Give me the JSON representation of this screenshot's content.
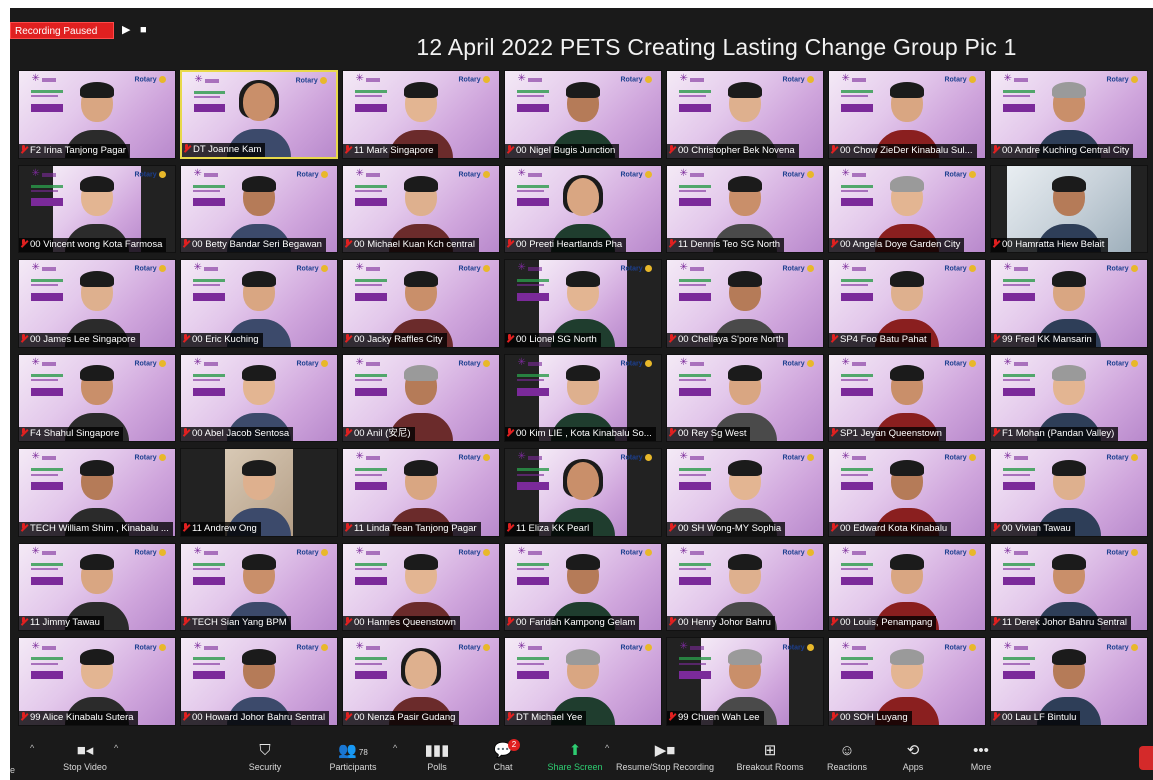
{
  "recording": {
    "status_label": "Recording Paused",
    "resume_icon": "play-icon",
    "stop_icon": "stop-icon"
  },
  "meeting_title": "12 April 2022 PETS Creating Lasting Change Group Pic 1",
  "colors": {
    "window_bg": "#1a1a1a",
    "recording_red": "#e02020",
    "active_speaker_border": "#e8d94a",
    "share_green": "#2ecc71",
    "tile_gradient_light": "#f4eaf6",
    "tile_gradient_dark": "#b889cc"
  },
  "background_branding": {
    "rotary_text": "Rotary"
  },
  "participants": [
    {
      "name": "F2 Irina Tanjong Pagar"
    },
    {
      "name": "DT Joanne Kam"
    },
    {
      "name": "11 Mark Singapore"
    },
    {
      "name": "00 Nigel Bugis Junction"
    },
    {
      "name": "00 Christopher Bek Novena"
    },
    {
      "name": "00 Chow ZieDer Kinabalu Sul..."
    },
    {
      "name": "00 Andre Kuching Central City"
    },
    {
      "name": "00 Vincent wong Kota Farmosa"
    },
    {
      "name": "00 Betty Bandar Seri Begawan"
    },
    {
      "name": "00 Michael Kuan Kch central"
    },
    {
      "name": "00 Preeti Heartlands Pha"
    },
    {
      "name": "11 Dennis Teo SG North"
    },
    {
      "name": "00 Angela Doye Garden City"
    },
    {
      "name": "00 Hamratta Hiew Belait"
    },
    {
      "name": "00 James Lee Singapore"
    },
    {
      "name": "00 Eric Kuching"
    },
    {
      "name": "00 Jacky Raffles City"
    },
    {
      "name": "00 Lionel SG North"
    },
    {
      "name": "00 Chellaya S'pore North"
    },
    {
      "name": "SP4 Foo Batu Pahat"
    },
    {
      "name": "99 Fred KK Mansarin"
    },
    {
      "name": "F4 Shahul Singapore"
    },
    {
      "name": "00 Abel Jacob Sentosa"
    },
    {
      "name": "00 Anil (安尼)"
    },
    {
      "name": "00 Kim LIE , Kota Kinabalu So..."
    },
    {
      "name": "00 Rey Sg West"
    },
    {
      "name": "SP1 Jeyan Queenstown"
    },
    {
      "name": "F1 Mohan (Pandan Valley)"
    },
    {
      "name": "TECH William Shim , Kinabalu ..."
    },
    {
      "name": "11 Andrew Ong"
    },
    {
      "name": "11 Linda Tean Tanjong Pagar"
    },
    {
      "name": "11 Eliza KK Pearl"
    },
    {
      "name": "00 SH Wong-MY Sophia"
    },
    {
      "name": "00 Edward Kota Kinabalu"
    },
    {
      "name": "00 Vivian Tawau"
    },
    {
      "name": "11 Jimmy Tawau"
    },
    {
      "name": "TECH Sian Yang BPM"
    },
    {
      "name": "00 Hannes Queenstown"
    },
    {
      "name": "00 Faridah Kampong Gelam"
    },
    {
      "name": "00 Henry Johor Bahru"
    },
    {
      "name": "00 Louis, Penampang"
    },
    {
      "name": "11 Derek Johor Bahru Sentral"
    },
    {
      "name": "99 Alice Kinabalu Sutera"
    },
    {
      "name": "00 Howard Johor Bahru Sentral"
    },
    {
      "name": "00 Nenza Pasir Gudang"
    },
    {
      "name": "DT Michael Yee"
    },
    {
      "name": "99 Chuen Wah Lee"
    },
    {
      "name": "00 SOH Luyang"
    },
    {
      "name": "00 Lau LF Bintulu"
    }
  ],
  "toolbar": {
    "edge_label": "e",
    "stop_video": "Stop Video",
    "security": "Security",
    "participants": "Participants",
    "participants_count": "78",
    "polls": "Polls",
    "chat": "Chat",
    "chat_badge": "2",
    "share_screen": "Share Screen",
    "resume_stop_recording": "Resume/Stop Recording",
    "breakout_rooms": "Breakout Rooms",
    "reactions": "Reactions",
    "apps": "Apps",
    "more": "More"
  }
}
